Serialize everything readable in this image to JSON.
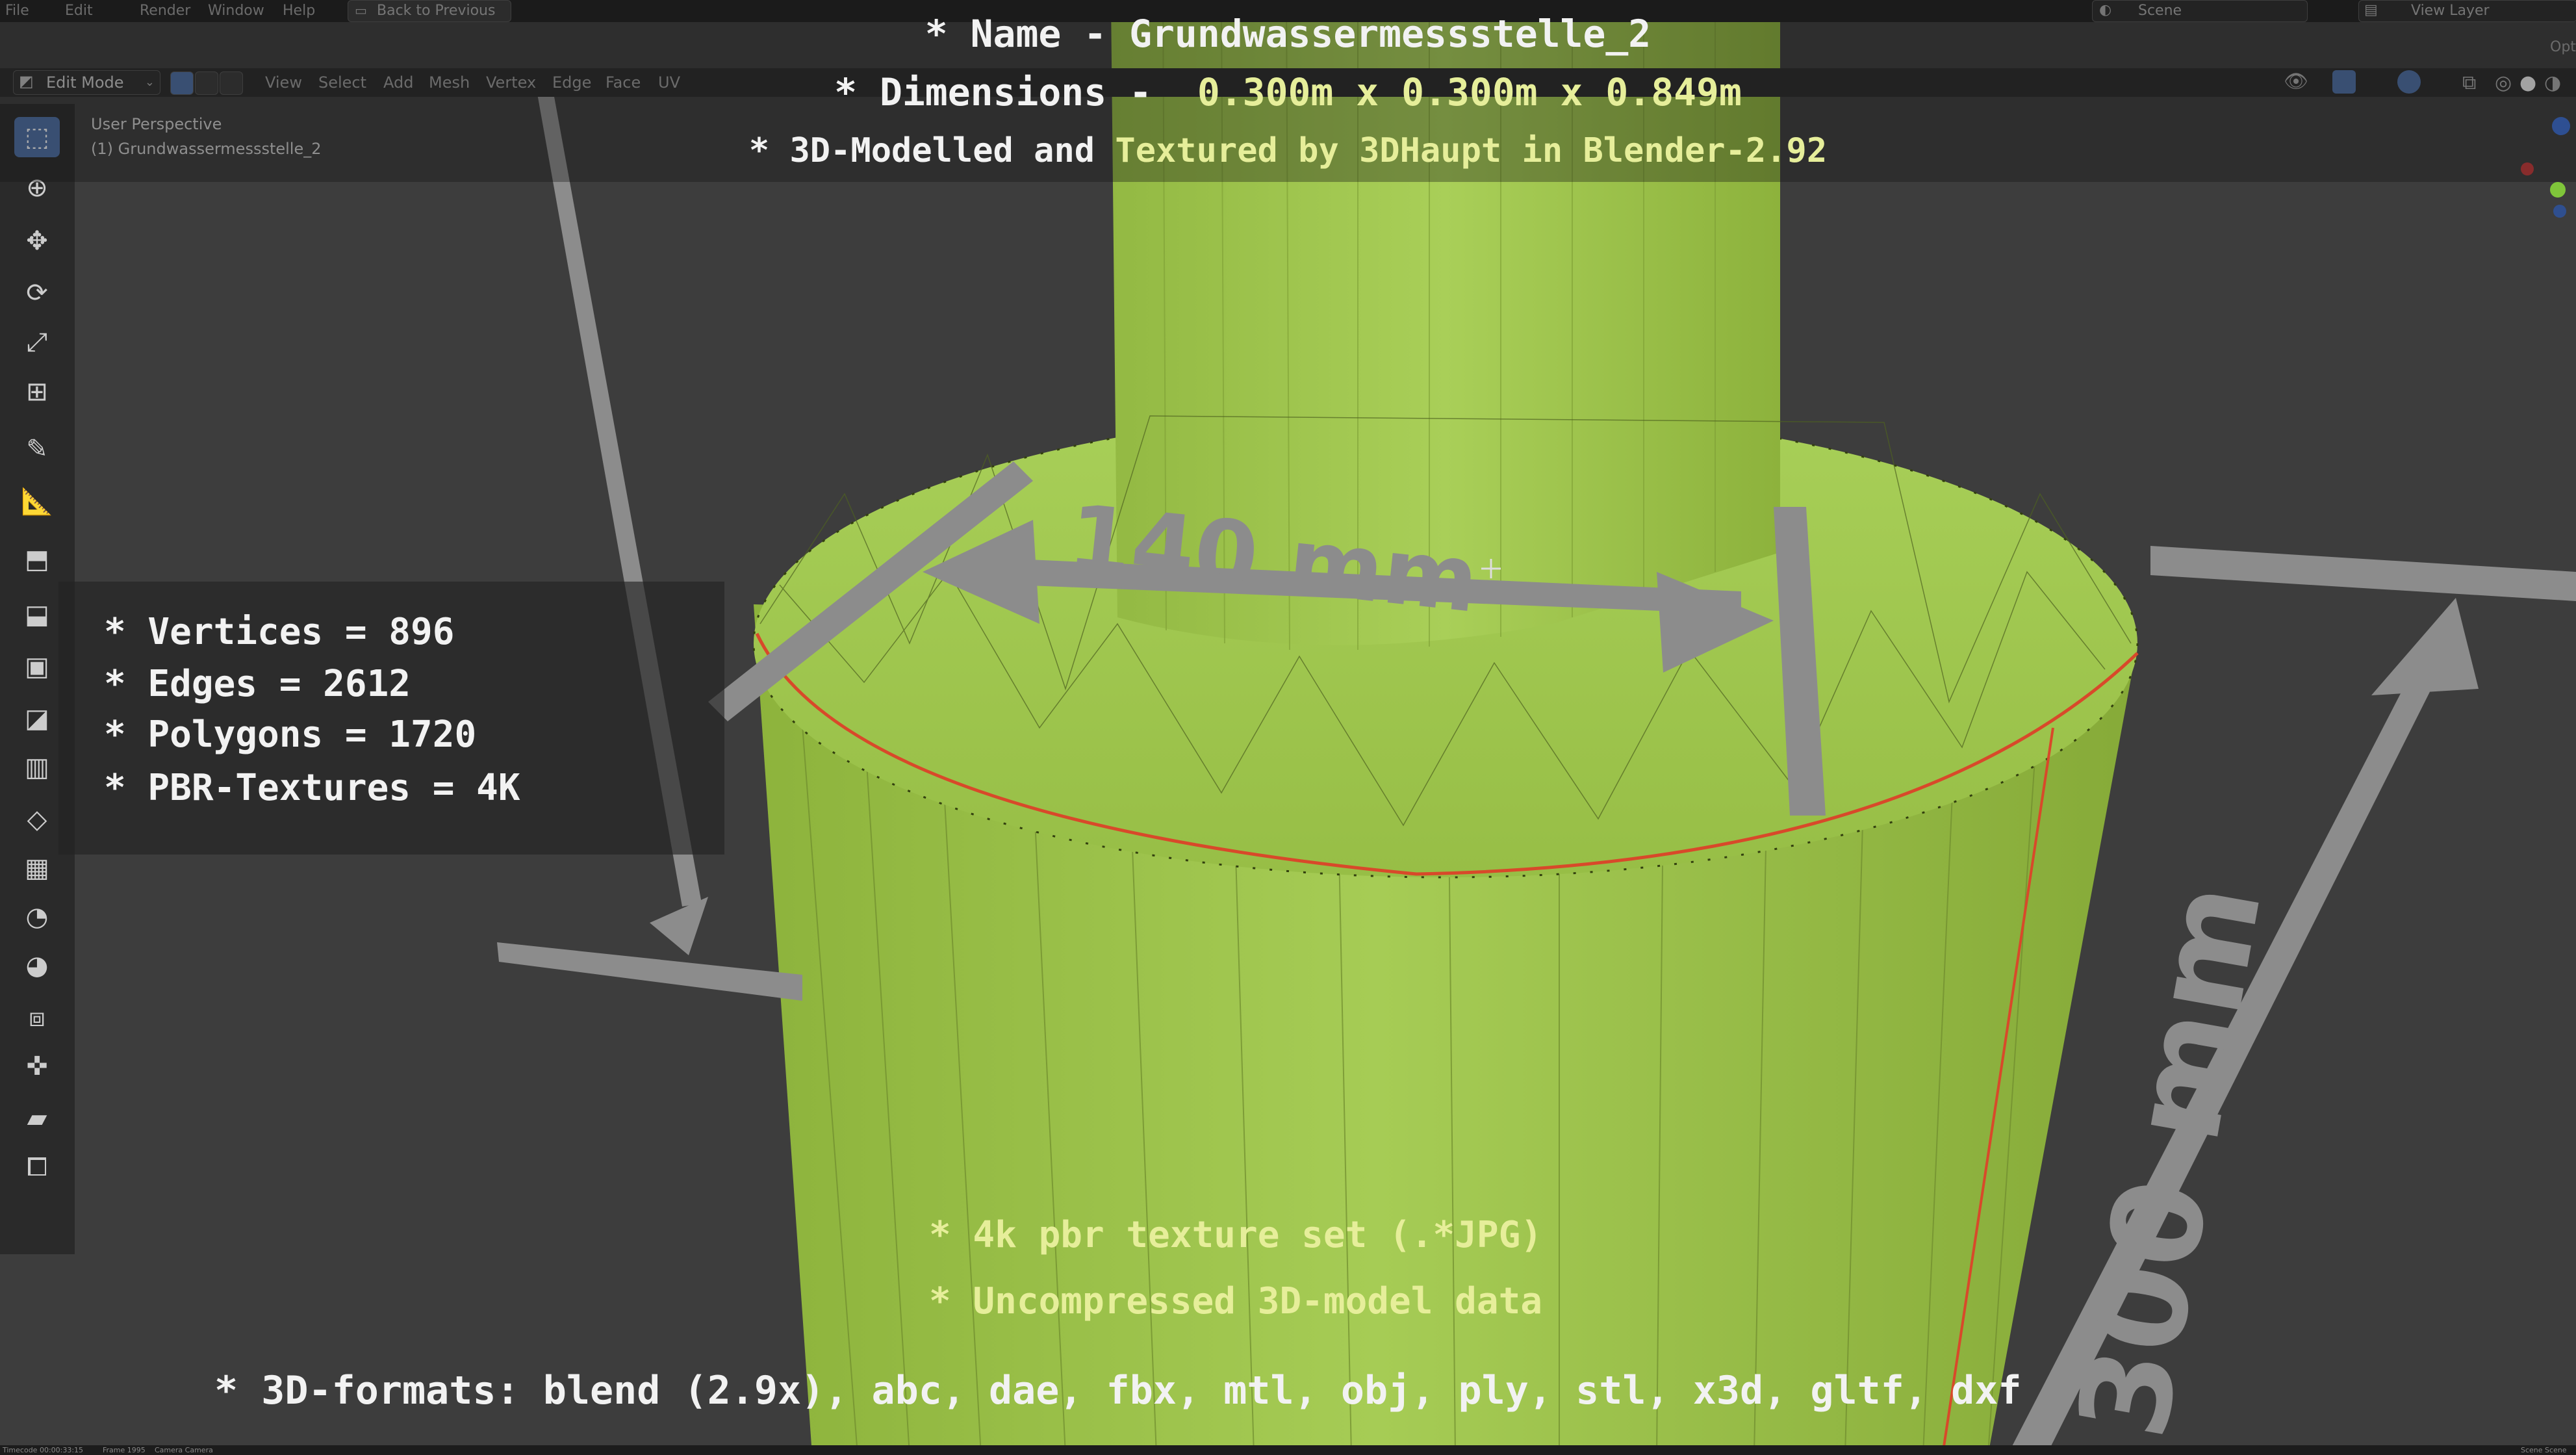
{
  "window": {
    "menu": [
      "File",
      "Edit",
      "Render",
      "Window",
      "Help"
    ],
    "back_button": "Back to Previous",
    "scene_label": "Scene",
    "view_layer_label": "View Layer",
    "options_label": "Opti"
  },
  "header": {
    "mode": "Edit Mode",
    "menus": [
      "View",
      "Select",
      "Add",
      "Mesh",
      "Vertex",
      "Edge",
      "Face",
      "UV"
    ]
  },
  "viewport": {
    "perspective": "User Perspective",
    "object": "(1) Grundwassermessstelle_2",
    "dimension_top": "140 mm",
    "dimension_side": "300 mm"
  },
  "overlay": {
    "name_line": "* Name - Grundwassermessstelle_2",
    "dim_prefix": "* Dimensions -  ",
    "dim_values": "0.300m x 0.300m x 0.849m",
    "credit_prefix": "* 3D-Modelled and ",
    "credit_highlight": "Textured by 3DHaupt in Blender-2.92",
    "stats": [
      "* Vertices = 896",
      "* Edges = 2612",
      "* Polygons = 1720",
      "* PBR-Textures = 4K"
    ],
    "texture_line": "* 4k pbr texture set (.*JPG)",
    "data_line": "* Uncompressed 3D-model data",
    "formats_line": "* 3D-formats: blend (2.9x), abc, dae, fbx, mtl, obj, ply, stl, x3d, gltf, dxf"
  },
  "statusbar": {
    "timecode": "Timecode 00:00:33:15",
    "frame": "Frame 1995",
    "camera": "Camera Camera",
    "scene_right": "Scene Scene"
  },
  "colors": {
    "model_green": "#9ac14a",
    "overlay_yellow": "#e6ee9a",
    "selected_edge": "#d8492a",
    "active_tool": "#4d6fa5"
  }
}
